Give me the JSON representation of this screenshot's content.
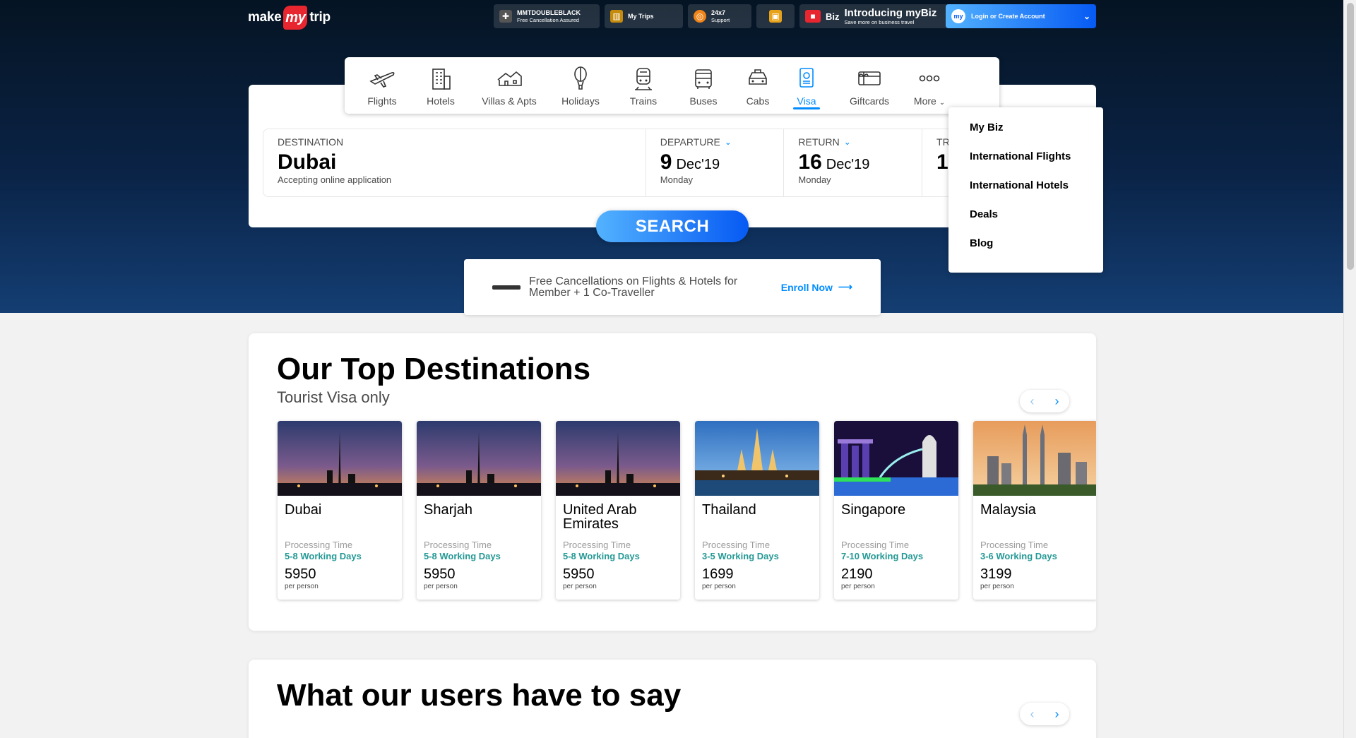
{
  "header": {
    "logo_make": "make",
    "logo_my": "my",
    "logo_trip": "trip",
    "double_black_title": "MMTDOUBLEBLACK",
    "double_black_sub": "Free Cancellation Assured",
    "my_trips": "My Trips",
    "support_title": "24x7",
    "support_sub": "Support",
    "biz_badge": "Biz",
    "mybiz_title": "Introducing myBiz",
    "mybiz_sub": "Save more on business travel",
    "login_label": "Login or Create Account"
  },
  "menu": {
    "items": [
      {
        "label": "Flights",
        "icon": "flight-icon"
      },
      {
        "label": "Hotels",
        "icon": "hotel-icon"
      },
      {
        "label": "Villas & Apts",
        "icon": "villa-icon"
      },
      {
        "label": "Holidays",
        "icon": "holiday-icon"
      },
      {
        "label": "Trains",
        "icon": "train-icon"
      },
      {
        "label": "Buses",
        "icon": "bus-icon"
      },
      {
        "label": "Cabs",
        "icon": "cab-icon"
      },
      {
        "label": "Visa",
        "icon": "visa-icon",
        "active": true
      },
      {
        "label": "Giftcards",
        "icon": "giftcard-icon"
      },
      {
        "label": "More",
        "icon": "more-icon"
      }
    ]
  },
  "search": {
    "destination_label": "DESTINATION",
    "destination_value": "Dubai",
    "destination_sub": "Accepting online application",
    "departure_label": "DEPARTURE",
    "departure_day": "9",
    "departure_month": "Dec'19",
    "departure_weekday": "Monday",
    "return_label": "RETURN",
    "return_day": "16",
    "return_month": "Dec'19",
    "return_weekday": "Monday",
    "travellers_label": "TR",
    "travellers_value": "1",
    "button": "SEARCH"
  },
  "more_dropdown": {
    "items": [
      "My Biz",
      "International Flights",
      "International Hotels",
      "Deals",
      "Blog"
    ]
  },
  "enroll": {
    "text": "Free Cancellations on Flights & Hotels for Member + 1 Co-Traveller",
    "link": "Enroll Now"
  },
  "top_destinations": {
    "title": "Our Top Destinations",
    "subtitle": "Tourist Visa only",
    "cards": [
      {
        "name": "Dubai",
        "processing_label": "Processing Time",
        "days": "5-8 Working Days",
        "price": "5950",
        "per": "per person"
      },
      {
        "name": "Sharjah",
        "processing_label": "Processing Time",
        "days": "5-8 Working Days",
        "price": "5950",
        "per": "per person"
      },
      {
        "name": "United Arab Emirates",
        "processing_label": "Processing Time",
        "days": "5-8 Working Days",
        "price": "5950",
        "per": "per person"
      },
      {
        "name": "Thailand",
        "processing_label": "Processing Time",
        "days": "3-5 Working Days",
        "price": "1699",
        "per": "per person"
      },
      {
        "name": "Singapore",
        "processing_label": "Processing Time",
        "days": "7-10 Working Days",
        "price": "2190",
        "per": "per person"
      },
      {
        "name": "Malaysia",
        "processing_label": "Processing Time",
        "days": "3-6 Working Days",
        "price": "3199",
        "per": "per person"
      }
    ]
  },
  "reviews": {
    "title": "What our users have to say"
  },
  "colors": {
    "accent": "#008cff",
    "days_green": "#249995",
    "hero_dark": "#051423"
  }
}
